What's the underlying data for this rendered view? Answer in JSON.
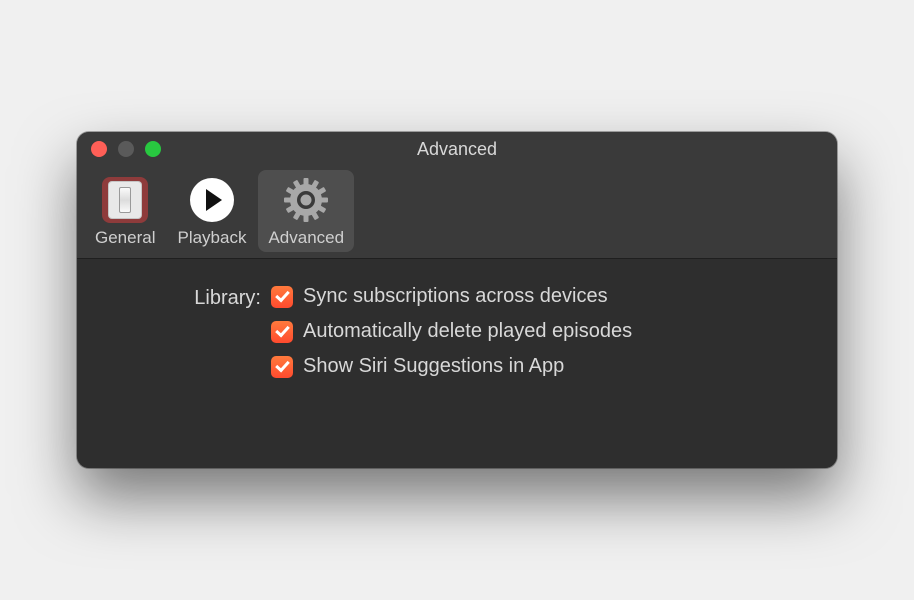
{
  "window": {
    "title": "Advanced"
  },
  "toolbar": {
    "items": [
      {
        "label": "General"
      },
      {
        "label": "Playback"
      },
      {
        "label": "Advanced"
      }
    ]
  },
  "content": {
    "section_label": "Library:",
    "options": [
      {
        "label": "Sync subscriptions across devices",
        "checked": true
      },
      {
        "label": "Automatically delete played episodes",
        "checked": true
      },
      {
        "label": "Show Siri Suggestions in App",
        "checked": true
      }
    ]
  }
}
